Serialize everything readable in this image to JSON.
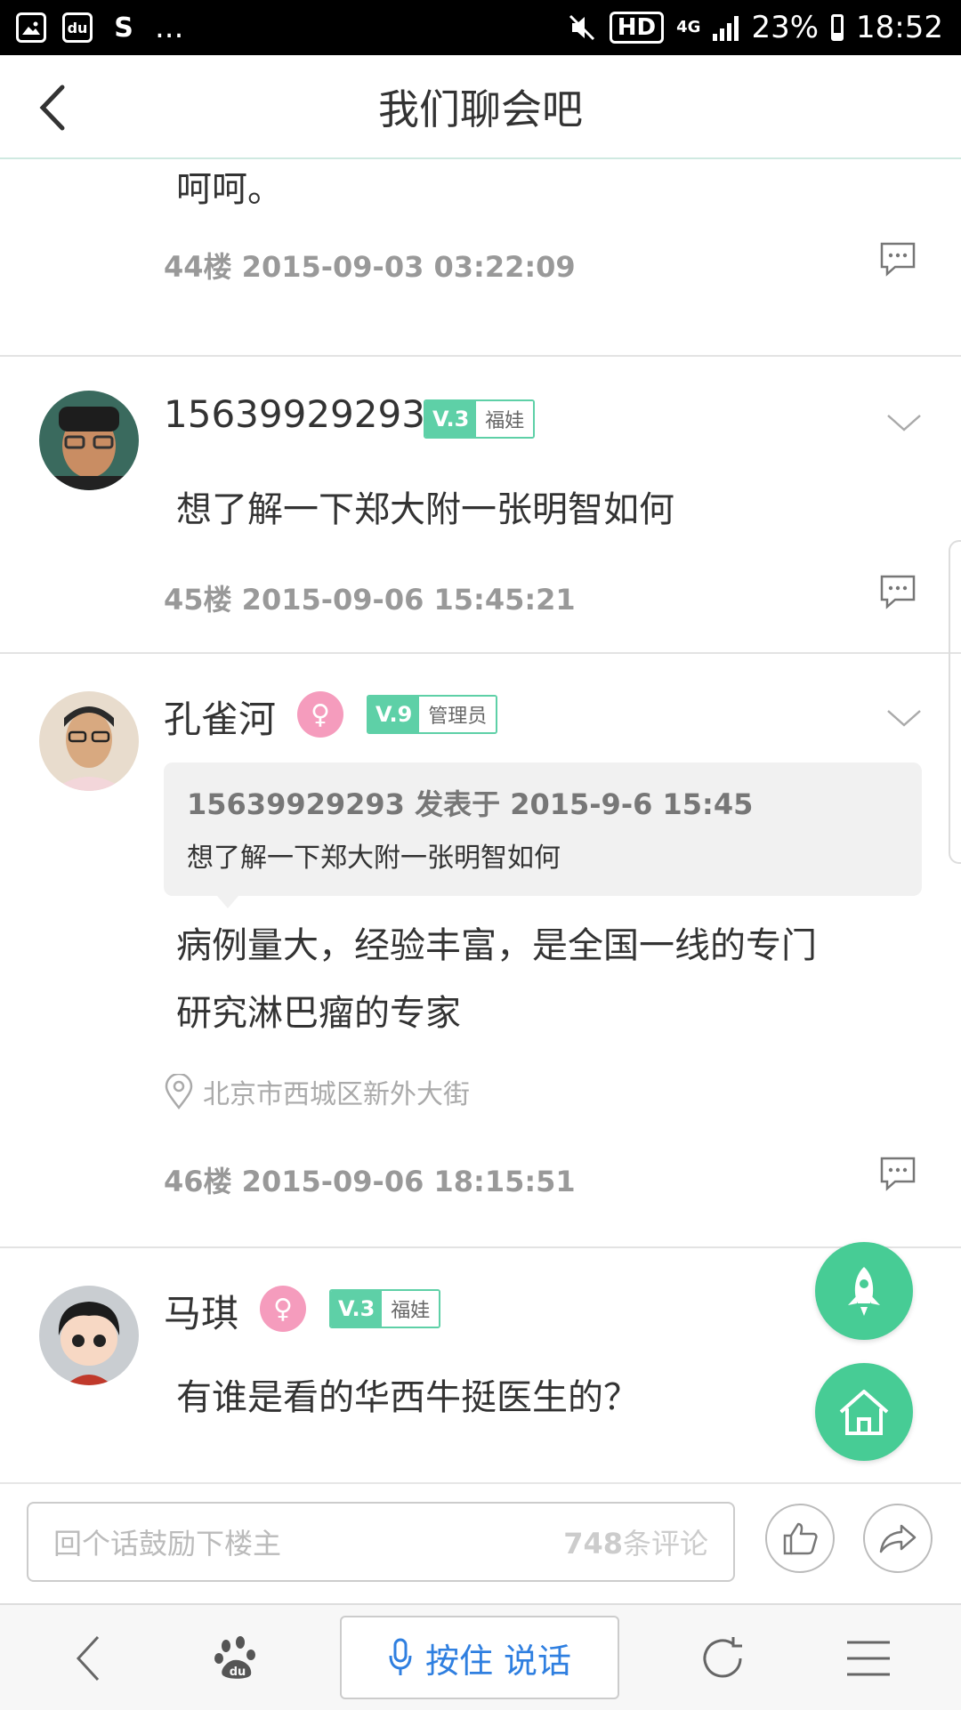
{
  "status_bar": {
    "left_icons": [
      "image-icon",
      "baidu-paw-icon",
      "s-app-icon"
    ],
    "overflow": "...",
    "hd": "HD",
    "network": "4G",
    "battery": "23%",
    "time": "18:52"
  },
  "header": {
    "title": "我们聊会吧"
  },
  "posts": [
    {
      "text_line": "呵呵。",
      "meta": "44楼 2015-09-03 03:22:09"
    },
    {
      "username": "15639929293",
      "level": "V.3",
      "role": "福娃",
      "text": "想了解一下郑大附一张明智如何",
      "meta": "45楼 2015-09-06 15:45:21"
    },
    {
      "username": "孔雀河",
      "gender_symbol": "♀",
      "level": "V.9",
      "role": "管理员",
      "quote_header": "15639929293 发表于 2015-9-6 15:45",
      "quote_body": "想了解一下郑大附一张明智如何",
      "text_line1": "病例量大，经验丰富，是全国一线的专门",
      "text_line2": "研究淋巴瘤的专家",
      "location": "北京市西城区新外大街",
      "meta": "46楼 2015-09-06 18:15:51"
    },
    {
      "username": "马琪",
      "gender_symbol": "♀",
      "level": "V.3",
      "role": "福娃",
      "text": "有谁是看的华西牛挺医生的？"
    }
  ],
  "comment_bar": {
    "placeholder": "回个话鼓励下楼主",
    "count": "748",
    "count_suffix": "条评论"
  },
  "browser_bar": {
    "talk_label": "按住 说话"
  },
  "colors": {
    "accent_green": "#47cc95",
    "badge_green": "#5ed0a7",
    "female_pink": "#f59cbd",
    "talk_blue": "#2f7fe0"
  }
}
